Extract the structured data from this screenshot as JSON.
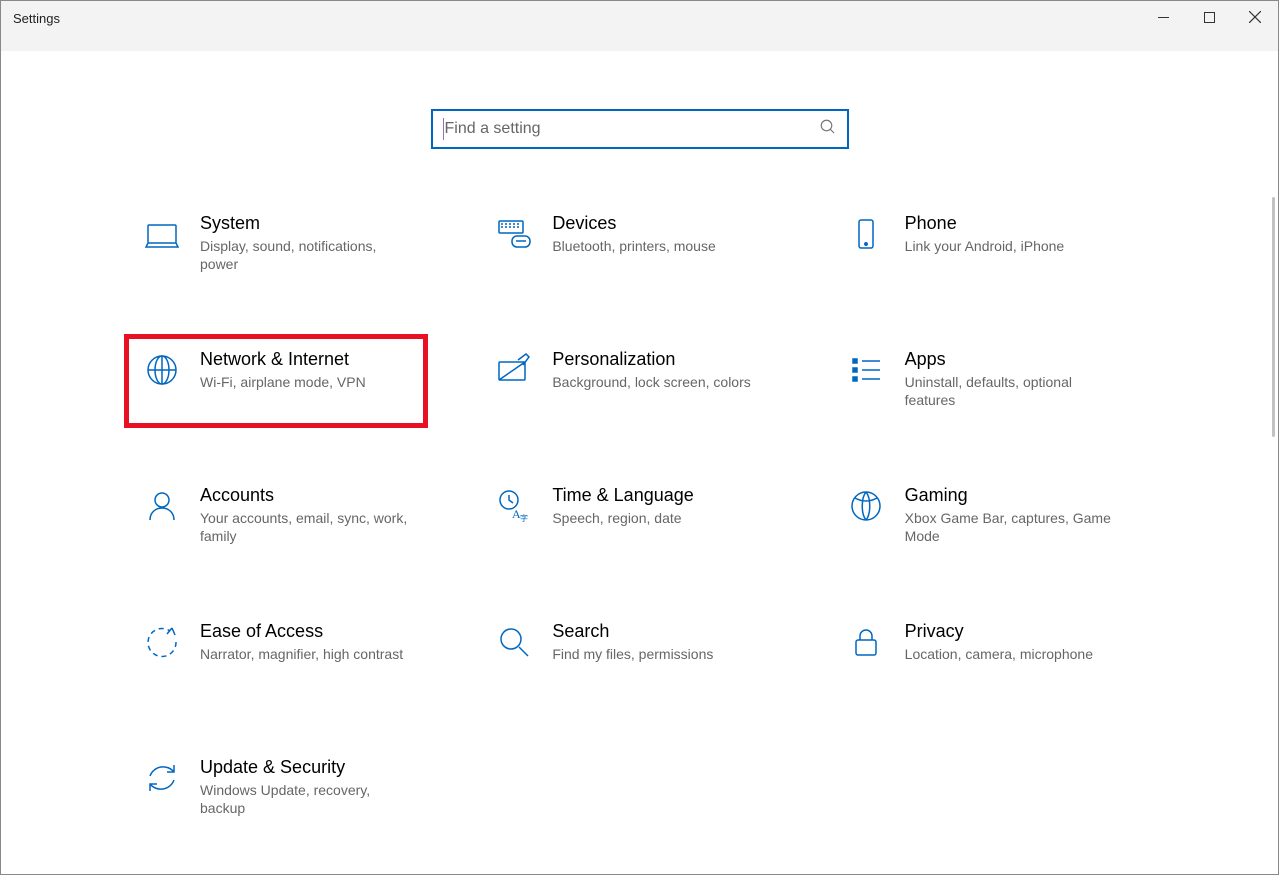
{
  "window": {
    "title": "Settings"
  },
  "search": {
    "placeholder": "Find a setting"
  },
  "highlight_index": 3,
  "items": [
    {
      "id": "system",
      "name": "System",
      "desc": "Display, sound, notifications, power"
    },
    {
      "id": "devices",
      "name": "Devices",
      "desc": "Bluetooth, printers, mouse"
    },
    {
      "id": "phone",
      "name": "Phone",
      "desc": "Link your Android, iPhone"
    },
    {
      "id": "network",
      "name": "Network & Internet",
      "desc": "Wi-Fi, airplane mode, VPN"
    },
    {
      "id": "personalization",
      "name": "Personalization",
      "desc": "Background, lock screen, colors"
    },
    {
      "id": "apps",
      "name": "Apps",
      "desc": "Uninstall, defaults, optional features"
    },
    {
      "id": "accounts",
      "name": "Accounts",
      "desc": "Your accounts, email, sync, work, family"
    },
    {
      "id": "time",
      "name": "Time & Language",
      "desc": "Speech, region, date"
    },
    {
      "id": "gaming",
      "name": "Gaming",
      "desc": "Xbox Game Bar, captures, Game Mode"
    },
    {
      "id": "ease",
      "name": "Ease of Access",
      "desc": "Narrator, magnifier, high contrast"
    },
    {
      "id": "search",
      "name": "Search",
      "desc": "Find my files, permissions"
    },
    {
      "id": "privacy",
      "name": "Privacy",
      "desc": "Location, camera, microphone"
    },
    {
      "id": "update",
      "name": "Update & Security",
      "desc": "Windows Update, recovery, backup"
    }
  ]
}
